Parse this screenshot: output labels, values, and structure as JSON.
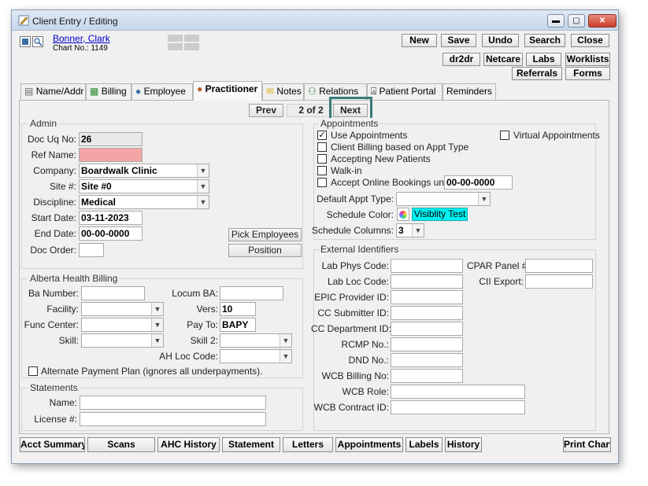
{
  "window": {
    "title": "Client Entry / Editing"
  },
  "patient": {
    "name": "Bonner, Clark",
    "chart_label": "Chart No.:",
    "chart_no": "1149"
  },
  "toolbar": {
    "new": "New",
    "save": "Save",
    "undo": "Undo",
    "search": "Search",
    "close": "Close",
    "dr2dr": "dr2dr",
    "netcare": "Netcare",
    "labs": "Labs",
    "worklists": "Worklists",
    "referrals": "Referrals",
    "forms": "Forms"
  },
  "tabs": [
    "Name/Addr",
    "Billing",
    "Employee",
    "Practitioner",
    "Notes",
    "Relations",
    "Patient Portal",
    "Reminders"
  ],
  "pager": {
    "prev": "Prev",
    "page": "2 of 2",
    "next": "Next"
  },
  "admin": {
    "legend": "Admin",
    "doc_uq_label": "Doc Uq No:",
    "doc_uq": "26",
    "ref_name_label": "Ref Name:",
    "ref_name": "",
    "company_label": "Company:",
    "company": "Boardwalk Clinic",
    "site_label": "Site #:",
    "site": "Site #0",
    "discipline_label": "Discipline:",
    "discipline": "Medical",
    "start_label": "Start Date:",
    "start": "03-11-2023",
    "end_label": "End Date:",
    "end": "00-00-0000",
    "order_label": "Doc Order:",
    "order": "",
    "pick_employees": "Pick Employees",
    "position": "Position"
  },
  "ahb": {
    "legend": "Alberta Health Billing",
    "ba_label": "Ba Number:",
    "locum_label": "Locum BA:",
    "facility_label": "Facility:",
    "vers_label": "Vers:",
    "vers": "10",
    "func_label": "Func Center:",
    "payto_label": "Pay To:",
    "payto": "BAPY",
    "skill_label": "Skill:",
    "skill2_label": "Skill 2:",
    "ahloc_label": "AH Loc Code:",
    "alt_plan": "Alternate Payment Plan (ignores all underpayments)."
  },
  "statements": {
    "legend": "Statements",
    "name_label": "Name:",
    "license_label": "License #:"
  },
  "appointments": {
    "legend": "Appointments",
    "use": "Use Appointments",
    "virtual": "Virtual Appointments",
    "client_billing": "Client Billing based on Appt Type",
    "accepting": "Accepting New Patients",
    "walkin": "Walk-in",
    "online": "Accept Online Bookings until",
    "online_date": "00-00-0000",
    "default_type_label": "Default Appt Type:",
    "color_label": "Schedule Color:",
    "color_value": "Visiblity Test",
    "columns_label": "Schedule Columns:",
    "columns": "3"
  },
  "external": {
    "legend": "External Identifiers",
    "lab_phys": "Lab Phys Code:",
    "lab_loc": "Lab Loc Code:",
    "epic": "EPIC Provider ID:",
    "cc_sub": "CC Submitter ID:",
    "cc_dept": "CC Department ID:",
    "rcmp": "RCMP No.:",
    "dnd": "DND No.:",
    "wcb_billing": "WCB Billing No:",
    "wcb_role": "WCB Role:",
    "wcb_contract": "WCB Contract ID:",
    "cpar": "CPAR Panel #",
    "cii": "CII Export:"
  },
  "bottom": {
    "acct": "Acct Summary",
    "scans": "Scans",
    "ahc": "AHC History",
    "statement": "Statement",
    "letters": "Letters",
    "appointments": "Appointments",
    "labels": "Labels",
    "history": "History",
    "print": "Print Chart"
  },
  "colors": {
    "ref_name_bg": "#f4a4a4",
    "color_swatch": "#00f0f0",
    "highlight": "#3a7a7a"
  }
}
